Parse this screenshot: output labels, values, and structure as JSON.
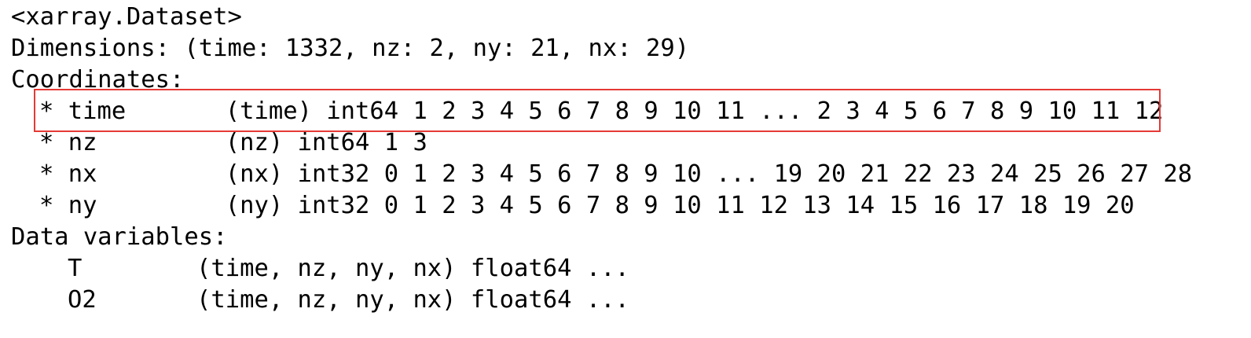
{
  "dataset": {
    "repr_header": "<xarray.Dataset>",
    "dimensions_label": "Dimensions:",
    "dimensions_value": " (time: 1332, nz: 2, ny: 21, nx: 29)",
    "coordinates_label": "Coordinates:",
    "coordinates": [
      {
        "marker": "*",
        "name": "time",
        "dims": "(time)",
        "dtype": "int64",
        "values": "1 2 3 4 5 6 7 8 9 10 11 ... 2 3 4 5 6 7 8 9 10 11 12"
      },
      {
        "marker": "*",
        "name": "nz",
        "dims": "(nz)",
        "dtype": "int64",
        "values": "1 3"
      },
      {
        "marker": "*",
        "name": "nx",
        "dims": "(nx)",
        "dtype": "int32",
        "values": "0 1 2 3 4 5 6 7 8 9 10 ... 19 20 21 22 23 24 25 26 27 28"
      },
      {
        "marker": "*",
        "name": "ny",
        "dims": "(ny)",
        "dtype": "int32",
        "values": "0 1 2 3 4 5 6 7 8 9 10 11 12 13 14 15 16 17 18 19 20"
      }
    ],
    "data_variables_label": "Data variables:",
    "data_variables": [
      {
        "name": "T",
        "dims": "(time, nz, ny, nx)",
        "dtype": "float64",
        "values": "..."
      },
      {
        "name": "O2",
        "dims": "(time, nz, ny, nx)",
        "dtype": "float64",
        "values": "..."
      }
    ]
  },
  "annotation": {
    "highlight_color": "#e53935",
    "highlighted_item": "time"
  }
}
